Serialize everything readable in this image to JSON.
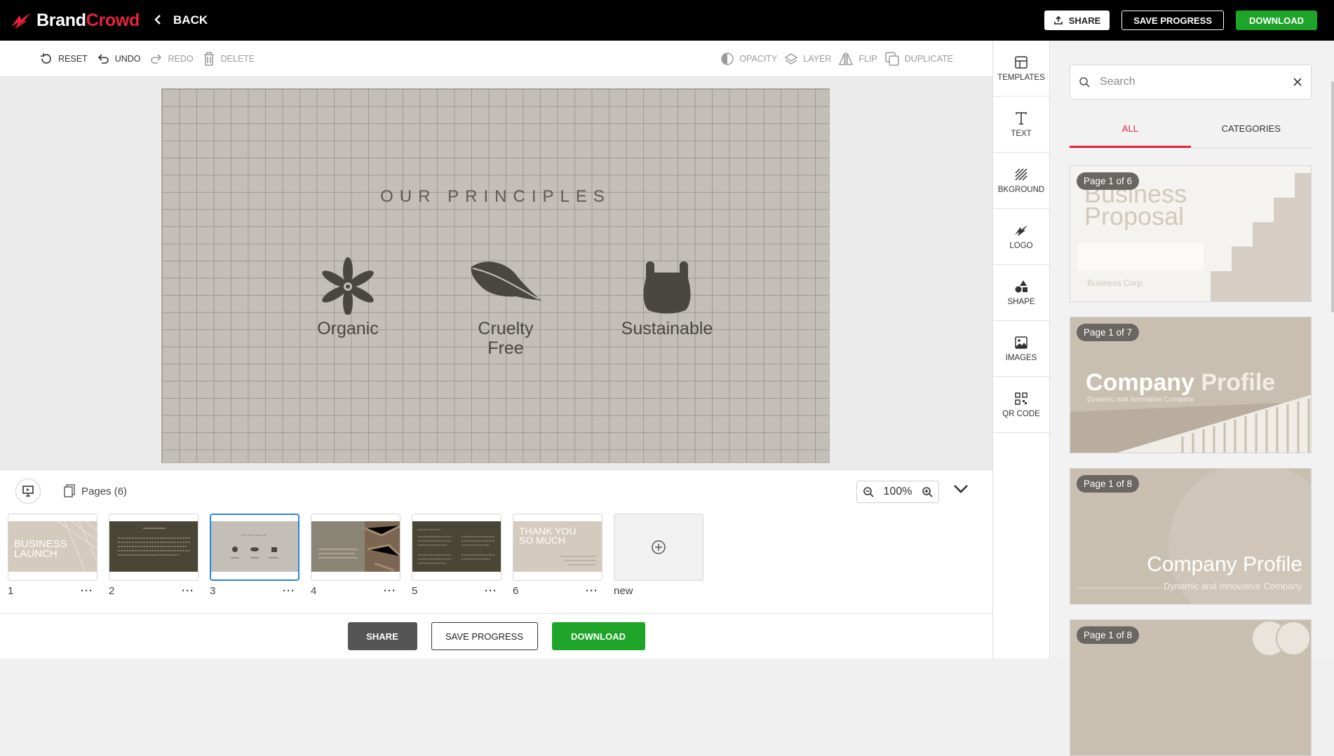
{
  "brand": {
    "name_first": "Brand",
    "name_second": "Crowd",
    "accent": "#e8233a"
  },
  "header": {
    "back_label": "BACK",
    "share_label": "SHARE",
    "save_label": "SAVE PROGRESS",
    "download_label": "DOWNLOAD"
  },
  "toolbar": {
    "reset": "RESET",
    "undo": "UNDO",
    "redo": "REDO",
    "delete": "DELETE",
    "opacity": "OPACITY",
    "layer": "LAYER",
    "flip": "FLIP",
    "duplicate": "DUPLICATE"
  },
  "canvas": {
    "title": "OUR PRINCIPLES",
    "principles": [
      {
        "icon": "flower-icon",
        "label": "Organic"
      },
      {
        "icon": "leaf-icon",
        "label_line1": "Cruelty",
        "label_line2": "Free"
      },
      {
        "icon": "bag-icon",
        "label": "Sustainable"
      }
    ]
  },
  "pages": {
    "label": "Pages (6)",
    "zoom": "100%",
    "items": [
      {
        "number": "1",
        "title1": "BUSINESS",
        "title2": "LAUNCH"
      },
      {
        "number": "2"
      },
      {
        "number": "3",
        "selected": true
      },
      {
        "number": "4"
      },
      {
        "number": "5"
      },
      {
        "number": "6",
        "title1": "THANK YOU",
        "title2": "SO MUCH"
      }
    ],
    "new_label": "new",
    "more": "···"
  },
  "bottom": {
    "share_label": "SHARE",
    "save_label": "SAVE PROGRESS",
    "download_label": "DOWNLOAD"
  },
  "sidetools": [
    {
      "icon": "templates-icon",
      "label": "TEMPLATES"
    },
    {
      "icon": "text-icon",
      "label": "TEXT"
    },
    {
      "icon": "background-icon",
      "label": "BKGROUND"
    },
    {
      "icon": "logo-icon",
      "label": "LOGO"
    },
    {
      "icon": "shape-icon",
      "label": "SHAPE"
    },
    {
      "icon": "images-icon",
      "label": "IMAGES"
    },
    {
      "icon": "qr-code-icon",
      "label": "QR CODE"
    }
  ],
  "templates": {
    "search_placeholder": "Search",
    "tab_all": "ALL",
    "tab_categories": "CATEGORIES",
    "cards": [
      {
        "badge": "Page 1 of 6",
        "title1": "Business",
        "title2": "Proposal",
        "sub": "Business Corp."
      },
      {
        "badge": "Page 1 of 7",
        "title1": "Company",
        "title2": "Profile",
        "sub": "Dynamic and Innovative Company"
      },
      {
        "badge": "Page 1 of 8",
        "title1": "Company Profile",
        "sub": "Dynamic and Innovative Company"
      },
      {
        "badge": "Page 1 of 8"
      }
    ]
  },
  "colors": {
    "green": "#1fa42a",
    "selected_blue": "#2a83e0",
    "canvas_bg": "#c3beb7"
  }
}
